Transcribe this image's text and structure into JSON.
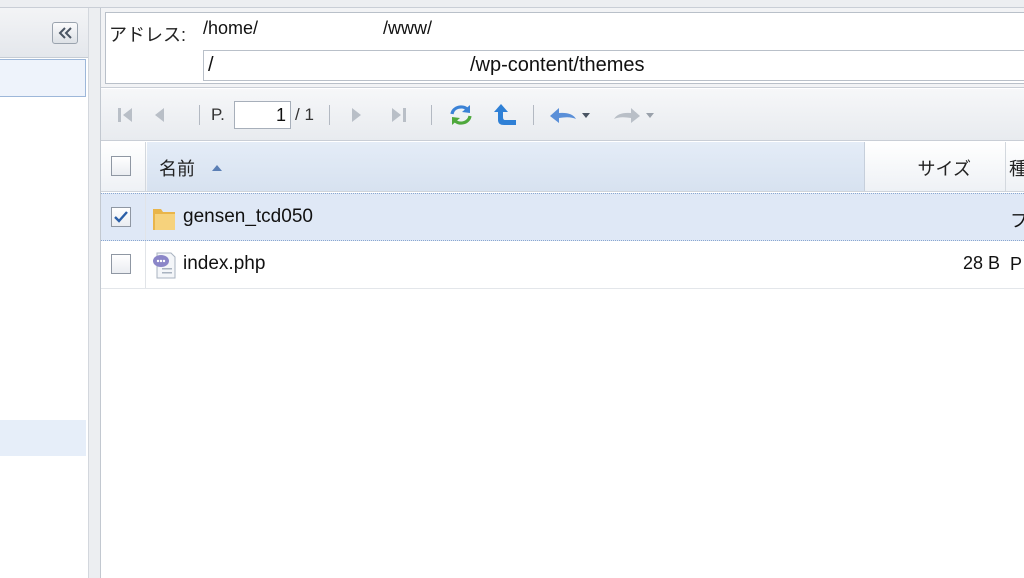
{
  "address": {
    "label": "アドレス:",
    "line1_part1": "/home/",
    "line1_part2": "/www/",
    "line2_part1": "/",
    "line2_part2": "/wp-content/themes"
  },
  "toolbar": {
    "page_prefix": "P.",
    "page_value": "1",
    "page_total": "/ 1"
  },
  "grid": {
    "col_name": "名前",
    "col_size": "サイズ",
    "col_type_partial": "種",
    "sort_icon": "sort-asc-icon"
  },
  "files": [
    {
      "name": "gensen_tcd050",
      "size": "",
      "type": "フ",
      "checked": true,
      "icon": "folder-icon"
    },
    {
      "name": "index.php",
      "size": "28 B",
      "type": "P",
      "checked": false,
      "icon": "php-file-icon"
    }
  ],
  "colors": {
    "selection": "#dfe8f6",
    "accent_blue": "#3a7fd5",
    "folder": "#f2c35a"
  }
}
